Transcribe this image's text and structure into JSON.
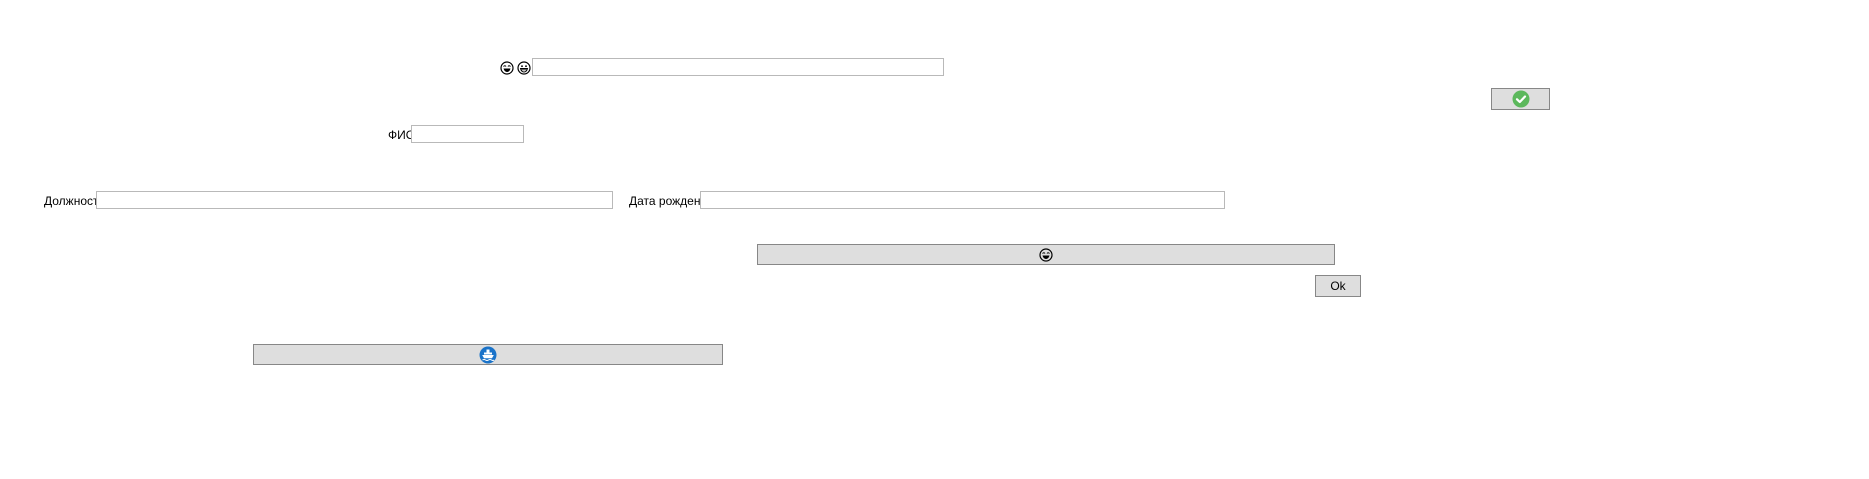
{
  "toolbar": {
    "emoji_icon_1": "laughing-face-icon",
    "emoji_icon_2": "grinning-face-icon",
    "top_input_value": ""
  },
  "confirm_button": {
    "icon": "green-checkmark-icon",
    "accent": "#5cb85c"
  },
  "form": {
    "fio_label": "ФИО",
    "fio_value": "",
    "position_label": "Должность",
    "position_value": "",
    "birthdate_label": "Дата рождения",
    "birthdate_value": ""
  },
  "emoji_button": {
    "icon": "laughing-face-icon"
  },
  "ok_button": {
    "label": "Ok"
  },
  "ship_button": {
    "icon": "blue-ship-icon",
    "accent": "#1a73c9"
  }
}
